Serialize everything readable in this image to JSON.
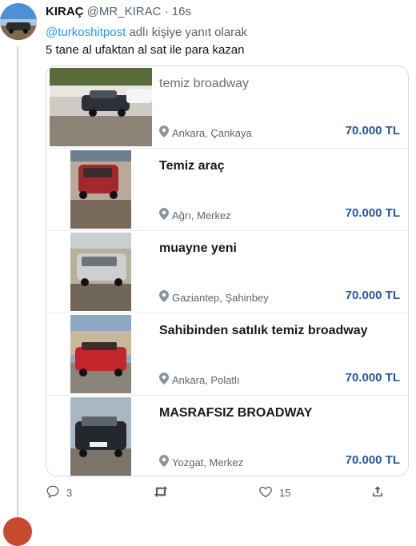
{
  "tweet": {
    "author_name": "KIRAÇ",
    "author_handle": "@MR_KIRAC",
    "separator": "·",
    "time": "16s",
    "reply_mention": "@turkoshitpost",
    "reply_suffix": "adlı kişiye yanıt olarak",
    "text": "5 tane al ufaktan al sat ile para kazan"
  },
  "listings": [
    {
      "title": "temiz broadway",
      "location": "Ankara, Çankaya",
      "price": "70.000 TL"
    },
    {
      "title": "Temiz araç",
      "location": "Ağrı, Merkez",
      "price": "70.000 TL"
    },
    {
      "title": "muayne yeni",
      "location": "Gaziantep, Şahinbey",
      "price": "70.000 TL"
    },
    {
      "title": "Sahibinden satılık temiz broadway",
      "location": "Ankara, Polatlı",
      "price": "70.000 TL"
    },
    {
      "title": "MASRAFSIZ BROADWAY",
      "location": "Yozgat, Merkez",
      "price": "70.000 TL"
    }
  ],
  "actions": {
    "reply_count": "3",
    "retweet_count": "",
    "like_count": "15"
  },
  "colors": {
    "price": "#2456a6",
    "mention": "#1d9bf0",
    "muted": "#536471"
  },
  "icons": [
    "location-pin-icon",
    "reply-icon",
    "retweet-icon",
    "like-icon",
    "share-icon"
  ]
}
